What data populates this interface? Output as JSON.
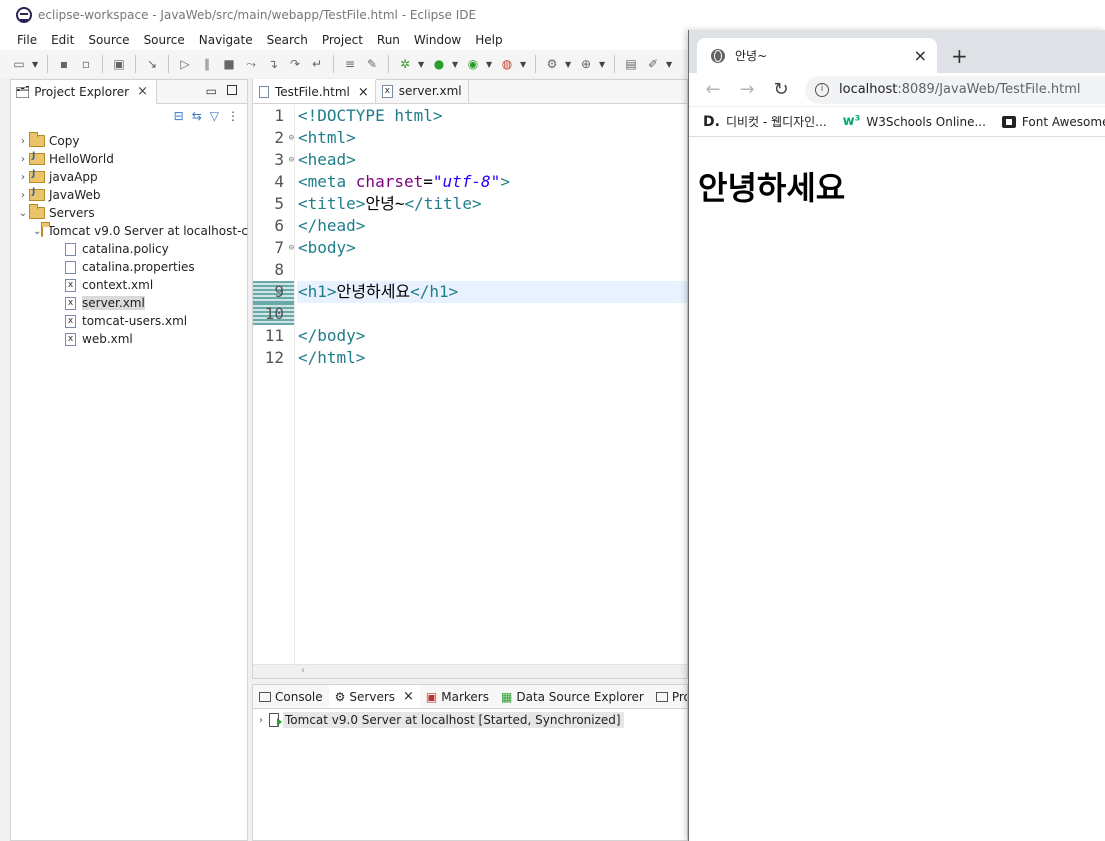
{
  "eclipse": {
    "title": "eclipse-workspace - JavaWeb/src/main/webapp/TestFile.html - Eclipse IDE",
    "menu": [
      "File",
      "Edit",
      "Source",
      "Source",
      "Navigate",
      "Search",
      "Project",
      "Run",
      "Window",
      "Help"
    ],
    "project_explorer": {
      "tab_label": "Project Explorer",
      "items": [
        {
          "label": "Copy"
        },
        {
          "label": "HelloWorld"
        },
        {
          "label": "javaApp"
        },
        {
          "label": "JavaWeb"
        },
        {
          "label": "Servers"
        },
        {
          "label": "Tomcat v9.0 Server at localhost-c"
        },
        {
          "label": "catalina.policy"
        },
        {
          "label": "catalina.properties"
        },
        {
          "label": "context.xml"
        },
        {
          "label": "server.xml"
        },
        {
          "label": "tomcat-users.xml"
        },
        {
          "label": "web.xml"
        }
      ]
    },
    "editor": {
      "tabs": [
        "TestFile.html",
        "server.xml"
      ],
      "line_numbers": [
        "1",
        "2",
        "3",
        "4",
        "5",
        "6",
        "7",
        "8",
        "9",
        "10",
        "11",
        "12"
      ],
      "code": {
        "l1a": "<!DOCTYPE ",
        "l1b": "html",
        "l1c": ">",
        "l2": "<html>",
        "l3": "<head>",
        "l4a": "<meta ",
        "l4b": "charset",
        "l4c": "=",
        "l4d": "\"utf-8\"",
        "l4e": ">",
        "l5a": "<title>",
        "l5b": "안녕~",
        "l5c": "</title>",
        "l6": "</head>",
        "l7": "<body>",
        "l9a": "<h1>",
        "l9b": "안녕하세요",
        "l9c": "</h1>",
        "l11": "</body>",
        "l12": "</html>"
      }
    },
    "bottom_panel": {
      "tabs": [
        "Console",
        "Servers",
        "Markers",
        "Data Source Explorer",
        "Proper"
      ],
      "server_row": "Tomcat v9.0 Server at localhost  [Started, Synchronized]"
    }
  },
  "chrome": {
    "tab_title": "안녕~",
    "address_host": "localhost",
    "address_path": ":8089/JavaWeb/TestFile.html",
    "bookmarks": [
      "디비컷 - 웹디자인...",
      "W3Schools Online...",
      "Font Awesome"
    ],
    "page_heading": "안녕하세요"
  }
}
